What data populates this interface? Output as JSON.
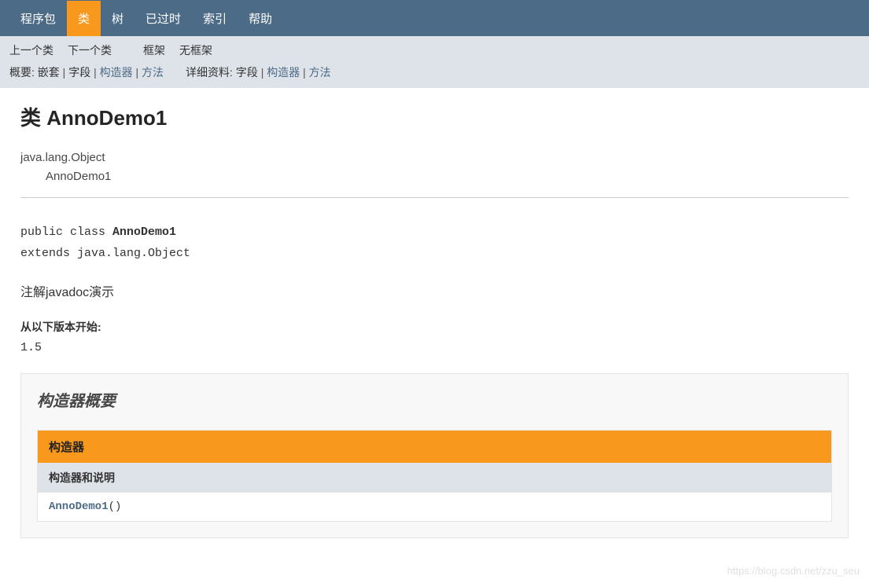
{
  "topNav": {
    "items": [
      {
        "label": "程序包",
        "active": false
      },
      {
        "label": "类",
        "active": true
      },
      {
        "label": "树",
        "active": false
      },
      {
        "label": "已过时",
        "active": false
      },
      {
        "label": "索引",
        "active": false
      },
      {
        "label": "帮助",
        "active": false
      }
    ]
  },
  "subNav": {
    "prev": "上一个类",
    "next": "下一个类",
    "frames": "框架",
    "noFrames": "无框架"
  },
  "summaryBar": {
    "summaryLabel": "概要:",
    "nested": "嵌套",
    "field": "字段",
    "constr": "构造器",
    "method": "方法",
    "detailLabel": "详细资料:",
    "dField": "字段",
    "dConstr": "构造器",
    "dMethod": "方法"
  },
  "page": {
    "titlePrefix": "类",
    "className": "AnnoDemo1",
    "inheritanceParent": "java.lang.Object",
    "inheritanceChild": "AnnoDemo1",
    "declPublic": "public class ",
    "declClass": "AnnoDemo1",
    "declExtends": "extends java.lang.Object",
    "description": "注解javadoc演示",
    "sinceLabel": "从以下版本开始:",
    "sinceValue": "1.5"
  },
  "constructorSection": {
    "heading": "构造器概要",
    "tableCaption": "构造器",
    "colHeader": "构造器和说明",
    "entryName": "AnnoDemo1",
    "entryParens": "()"
  },
  "watermark": "https://blog.csdn.net/zzu_seu"
}
